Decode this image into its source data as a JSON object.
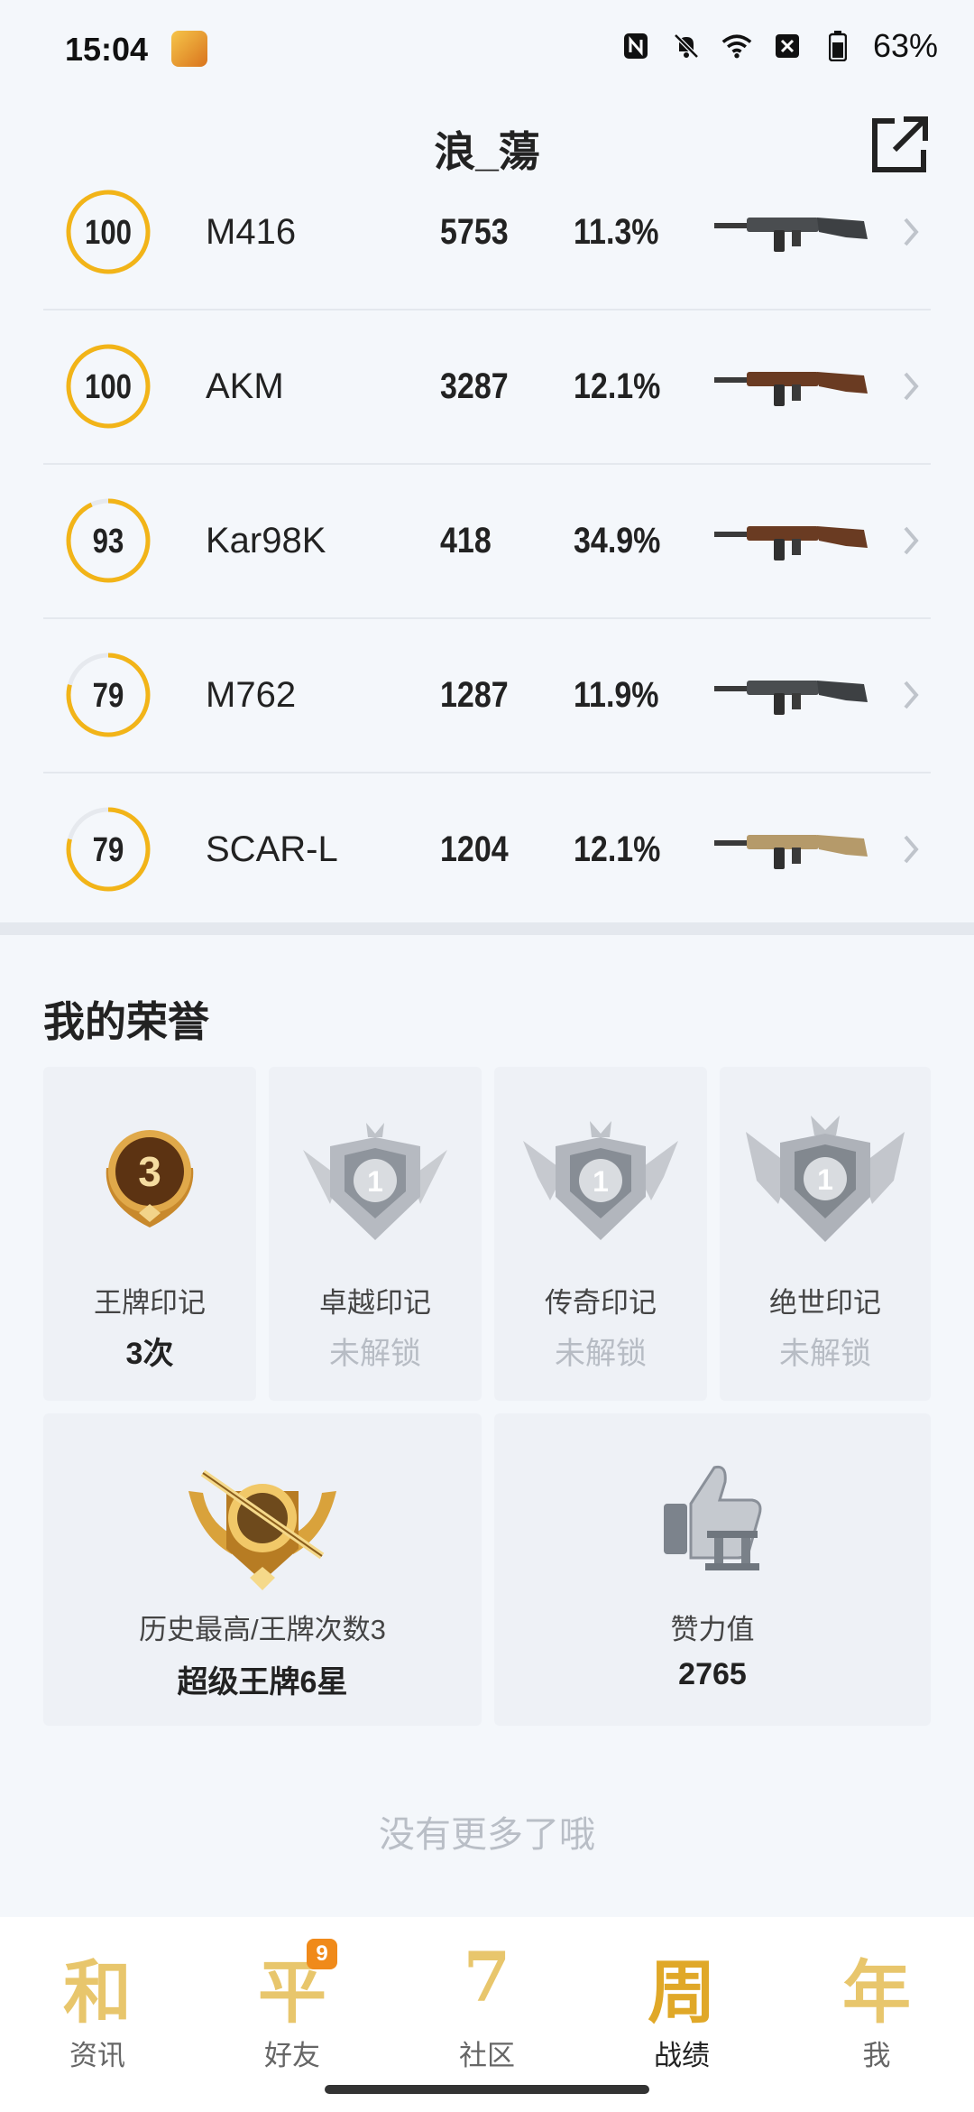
{
  "status_bar": {
    "time": "15:04",
    "battery": "63%"
  },
  "header": {
    "title": "浪_蕩"
  },
  "weapons": [
    {
      "score": "100",
      "score_value": 100,
      "name": "M416",
      "kills": "5753",
      "rate": "11.3%"
    },
    {
      "score": "100",
      "score_value": 100,
      "name": "AKM",
      "kills": "3287",
      "rate": "12.1%"
    },
    {
      "score": "93",
      "score_value": 93,
      "name": "Kar98K",
      "kills": "418",
      "rate": "34.9%"
    },
    {
      "score": "79",
      "score_value": 79,
      "name": "M762",
      "kills": "1287",
      "rate": "11.9%"
    },
    {
      "score": "79",
      "score_value": 79,
      "name": "SCAR-L",
      "kills": "1204",
      "rate": "12.1%"
    }
  ],
  "honors": {
    "title": "我的荣誉",
    "marks": [
      {
        "label": "王牌印记",
        "value": "3次",
        "badge_number": "3"
      },
      {
        "label": "卓越印记",
        "value": "未解锁",
        "badge_number": "1"
      },
      {
        "label": "传奇印记",
        "value": "未解锁",
        "badge_number": "1"
      },
      {
        "label": "绝世印记",
        "value": "未解锁",
        "badge_number": "1"
      }
    ],
    "best": {
      "label": "历史最高/王牌次数3",
      "value": "超级王牌6星"
    },
    "likes": {
      "label": "赞力值",
      "value": "2765"
    }
  },
  "no_more": "没有更多了哦",
  "nav": {
    "items": [
      {
        "glyph": "和",
        "label": "资讯"
      },
      {
        "glyph": "平",
        "label": "好友",
        "badge": "9"
      },
      {
        "glyph": "7",
        "label": "社区"
      },
      {
        "glyph": "周",
        "label": "战绩"
      },
      {
        "glyph": "年",
        "label": "我"
      }
    ]
  },
  "colors": {
    "ring": "#f2b418",
    "ring_track": "#e6e9ee",
    "accent_gold": "#e8c66c"
  }
}
